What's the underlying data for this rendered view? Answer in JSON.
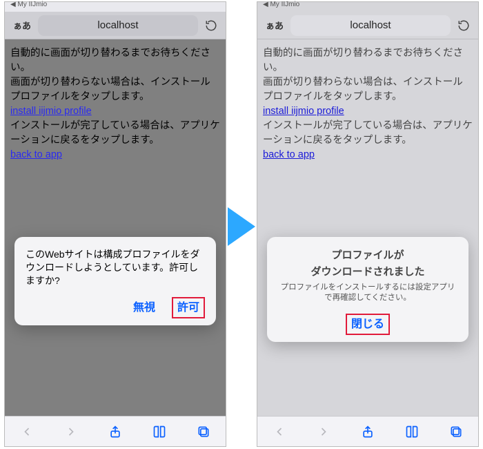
{
  "status_label": "My IIJmio",
  "addr": {
    "aa": "ぁあ",
    "url": "localhost"
  },
  "page": {
    "line1": "自動的に画面が切り替わるまでお待ちください。",
    "line2": "画面が切り替わらない場合は、インストールプロファイルをタップします。",
    "link1": "install iijmio profile",
    "line3": "インストールが完了している場合は、アプリケーションに戻るをタップします。",
    "link2": "back to app"
  },
  "dialog1": {
    "message": "このWebサイトは構成プロファイルをダウンロードしようとしています。許可しますか?",
    "ignore": "無視",
    "allow": "許可"
  },
  "dialog2": {
    "title1": "プロファイルが",
    "title2": "ダウンロードされました",
    "sub": "プロファイルをインストールするには設定アプリで再確認してください。",
    "close": "閉じる"
  },
  "icons": {
    "back": "back-icon",
    "forward": "forward-icon",
    "share": "share-icon",
    "bookmarks": "bookmarks-icon",
    "tabs": "tabs-icon",
    "refresh": "refresh-icon"
  }
}
